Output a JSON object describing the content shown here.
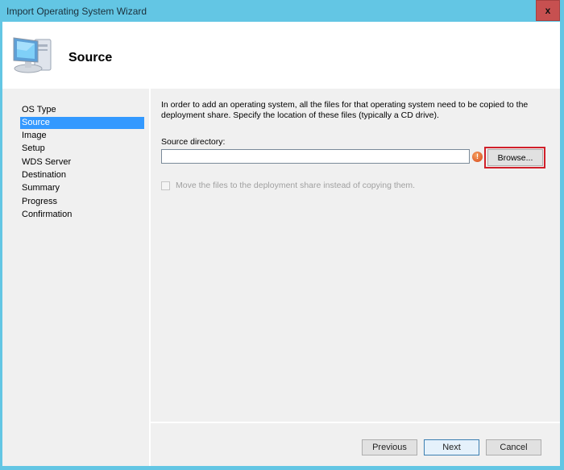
{
  "window": {
    "title": "Import Operating System Wizard",
    "close_label": "x"
  },
  "header": {
    "icon": "computer-icon",
    "title": "Source"
  },
  "nav": {
    "items": [
      {
        "label": "OS Type",
        "active": false
      },
      {
        "label": "Source",
        "active": true
      },
      {
        "label": "Image",
        "active": false
      },
      {
        "label": "Setup",
        "active": false
      },
      {
        "label": "WDS Server",
        "active": false
      },
      {
        "label": "Destination",
        "active": false
      },
      {
        "label": "Summary",
        "active": false
      },
      {
        "label": "Progress",
        "active": false
      },
      {
        "label": "Confirmation",
        "active": false
      }
    ]
  },
  "content": {
    "description": "In order to add an operating system, all the files for that operating system need to be copied to the deployment share.  Specify the location of these files (typically a CD drive).",
    "source_label": "Source directory:",
    "source_value": "",
    "error_icon": "error-icon",
    "browse_label": "Browse...",
    "move_checkbox_label": "Move the files to the deployment share instead of copying them.",
    "move_checkbox_checked": false,
    "move_checkbox_enabled": false
  },
  "footer": {
    "previous_label": "Previous",
    "next_label": "Next",
    "cancel_label": "Cancel"
  },
  "colors": {
    "titlebar": "#63c6e4",
    "close_button": "#c75050",
    "nav_selected": "#3399ff",
    "highlight_box": "#d0202a"
  }
}
